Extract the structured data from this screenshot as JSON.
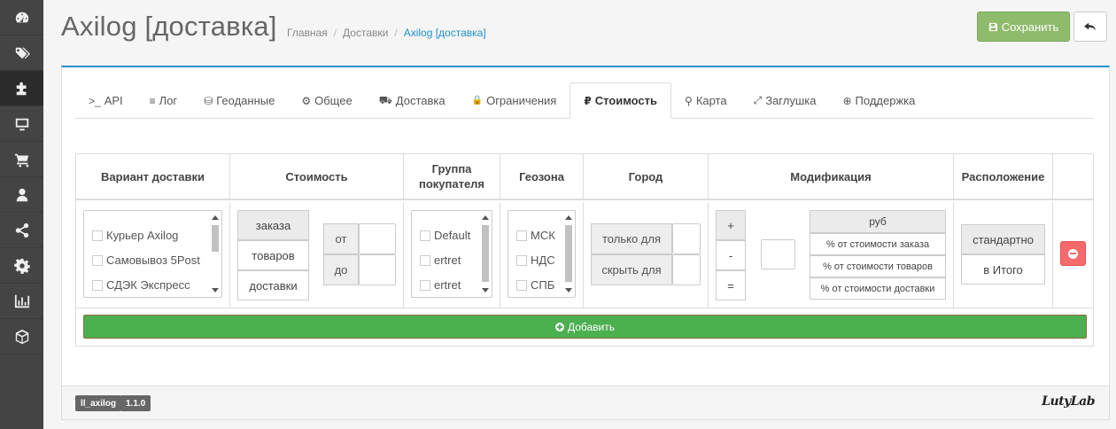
{
  "sidebar": {
    "items": [
      {
        "icon": "dashboard-icon"
      },
      {
        "icon": "tags-icon"
      },
      {
        "icon": "puzzle-icon",
        "active": true
      },
      {
        "icon": "monitor-icon"
      },
      {
        "icon": "cart-icon"
      },
      {
        "icon": "user-icon"
      },
      {
        "icon": "share-icon"
      },
      {
        "icon": "gear-icon"
      },
      {
        "icon": "bar-chart-icon"
      },
      {
        "icon": "cube-icon"
      }
    ]
  },
  "header": {
    "title": "Axilog [доставка]",
    "breadcrumb": [
      "Главная",
      "Доставки",
      "Axilog [доставка]"
    ],
    "save_label": "Сохранить"
  },
  "tabs": [
    {
      "icon": ">_",
      "label": "API"
    },
    {
      "icon": "≡",
      "label": "Лог"
    },
    {
      "icon": "⛁",
      "label": "Геоданные"
    },
    {
      "icon": "⚙",
      "label": "Общее"
    },
    {
      "icon": "⛟",
      "label": "Доставка"
    },
    {
      "icon": "🔒",
      "label": "Ограничения"
    },
    {
      "icon": "₽",
      "label": "Стоимость",
      "active": true
    },
    {
      "icon": "⚲",
      "label": "Карта"
    },
    {
      "icon": "⤢",
      "label": "Заглушка"
    },
    {
      "icon": "⊕",
      "label": "Поддержка"
    }
  ],
  "table": {
    "headers": {
      "variant": "Вариант доставки",
      "cost": "Стоимость",
      "group1": "Группа",
      "group2": "покупателя",
      "geozone": "Геозона",
      "city": "Город",
      "mod": "Модификация",
      "place": "Расположение"
    },
    "row": {
      "variants": [
        "Курьер Axilog",
        "Самовывоз 5Post",
        "СДЭК Экспресс"
      ],
      "cost_base": [
        "заказа",
        "товаров",
        "доставки"
      ],
      "cost_from": "от",
      "cost_to": "до",
      "groups": [
        "Default",
        "ertret",
        "ertret"
      ],
      "geozones": [
        "МСК",
        "НДС",
        "СПБ"
      ],
      "city_only": "только для",
      "city_hide": "скрыть для",
      "operators": [
        "+",
        "-",
        "="
      ],
      "mod_units": [
        "руб",
        "% от стоимости заказа",
        "% от стоимости товаров",
        "% от стоимости доставки"
      ],
      "placement": [
        "стандартно",
        "в Итого"
      ]
    },
    "add_label": "Добавить"
  },
  "footer": {
    "module": "ll_axilog",
    "version": "1.1.0",
    "brand": "LutyLab"
  },
  "colors": {
    "accent": "#1e91cf",
    "save": "#8fbb6c",
    "add": "#4caf50",
    "delete": "#f56b6b",
    "sidebar": "#444444"
  }
}
